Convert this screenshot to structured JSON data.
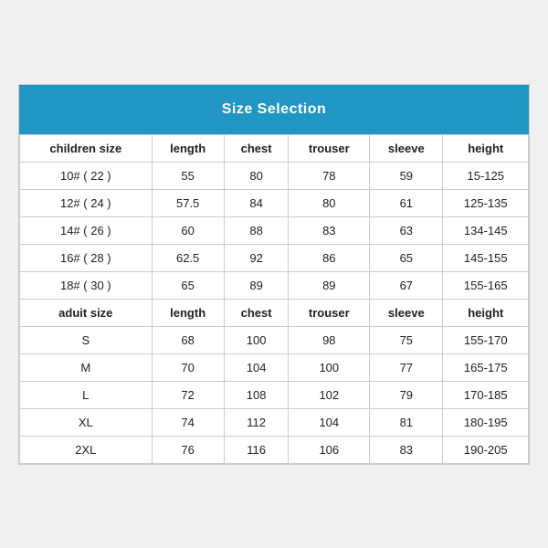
{
  "title": "Size Selection",
  "columns": [
    "children size",
    "length",
    "chest",
    "trouser",
    "sleeve",
    "height"
  ],
  "adult_columns": [
    "aduit size",
    "length",
    "chest",
    "trouser",
    "sleeve",
    "height"
  ],
  "children_rows": [
    [
      "10# ( 22 )",
      "55",
      "80",
      "78",
      "59",
      "15-125"
    ],
    [
      "12# ( 24 )",
      "57.5",
      "84",
      "80",
      "61",
      "125-135"
    ],
    [
      "14# ( 26 )",
      "60",
      "88",
      "83",
      "63",
      "134-145"
    ],
    [
      "16# ( 28 )",
      "62.5",
      "92",
      "86",
      "65",
      "145-155"
    ],
    [
      "18# ( 30 )",
      "65",
      "89",
      "89",
      "67",
      "155-165"
    ]
  ],
  "adult_rows": [
    [
      "S",
      "68",
      "100",
      "98",
      "75",
      "155-170"
    ],
    [
      "M",
      "70",
      "104",
      "100",
      "77",
      "165-175"
    ],
    [
      "L",
      "72",
      "108",
      "102",
      "79",
      "170-185"
    ],
    [
      "XL",
      "74",
      "112",
      "104",
      "81",
      "180-195"
    ],
    [
      "2XL",
      "76",
      "116",
      "106",
      "83",
      "190-205"
    ]
  ]
}
